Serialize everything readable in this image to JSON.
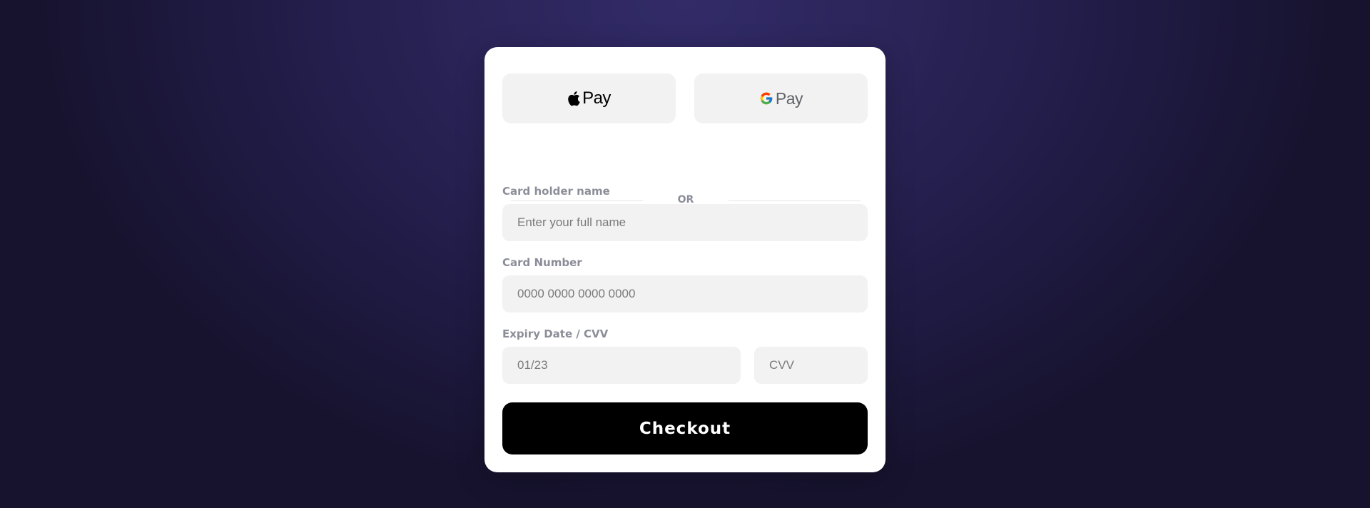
{
  "wallets": {
    "apple": {
      "label": "Pay",
      "icon": "apple-logo-icon"
    },
    "google": {
      "label": "Pay",
      "icon": "google-logo-icon"
    }
  },
  "divider": {
    "text": "OR"
  },
  "form": {
    "cardholder": {
      "label": "Card holder name",
      "placeholder": "Enter your full name",
      "value": ""
    },
    "card_number": {
      "label": "Card Number",
      "placeholder": "0000 0000 0000 0000",
      "value": ""
    },
    "expiry_cvv": {
      "label": "Expiry Date / CVV",
      "expiry_placeholder": "01/23",
      "cvv_placeholder": "CVV"
    }
  },
  "checkout": {
    "label": "Checkout"
  },
  "colors": {
    "background": "#221d4a",
    "card": "#ffffff",
    "input_bg": "#f2f2f2",
    "label": "#8b8e98",
    "button": "#000000"
  }
}
